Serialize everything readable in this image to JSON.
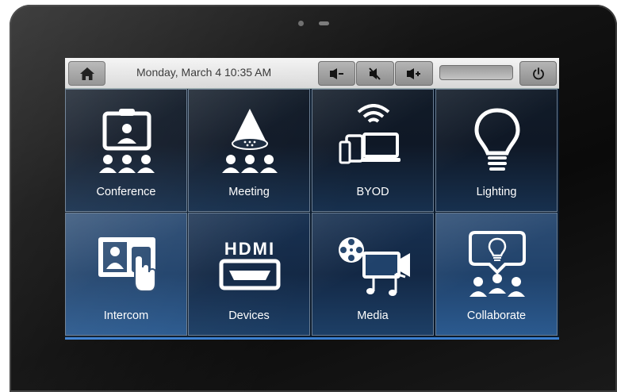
{
  "colors": {
    "accent": "#2b5a8f",
    "tile_text": "#ffffff",
    "topbar": "#e6e6e6"
  },
  "topbar": {
    "home_icon": "home-icon",
    "datetime": "Monday, March 4 10:35 AM",
    "volume_down_icon": "volume-down-icon",
    "mute_icon": "mute-icon",
    "volume_up_icon": "volume-up-icon",
    "power_icon": "power-icon"
  },
  "tiles": [
    {
      "label": "Conference",
      "icon": "video-conference-icon"
    },
    {
      "label": "Meeting",
      "icon": "conference-phone-icon"
    },
    {
      "label": "BYOD",
      "icon": "byod-devices-icon"
    },
    {
      "label": "Lighting",
      "icon": "lightbulb-icon"
    },
    {
      "label": "Intercom",
      "icon": "intercom-icon"
    },
    {
      "label": "Devices",
      "icon": "hdmi-icon"
    },
    {
      "label": "Media",
      "icon": "media-icon"
    },
    {
      "label": "Collaborate",
      "icon": "collaborate-icon"
    }
  ]
}
